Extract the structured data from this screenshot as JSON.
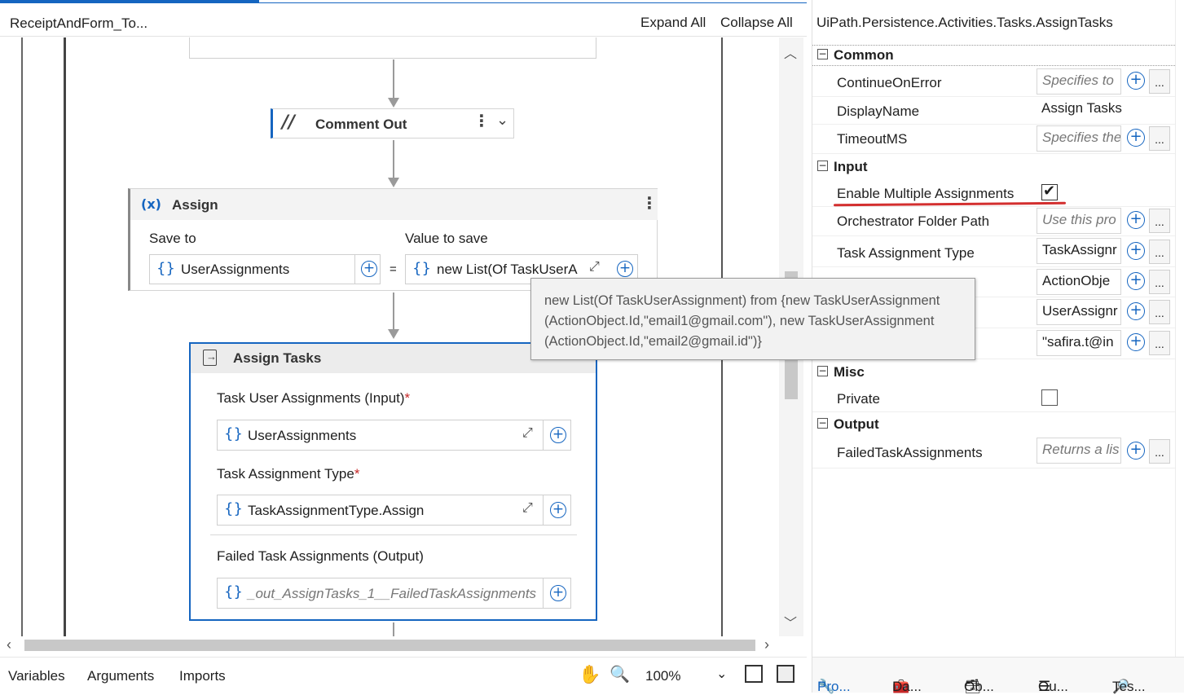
{
  "header": {
    "title": "ReceiptAndForm_To...",
    "expand_all": "Expand All",
    "collapse_all": "Collapse All"
  },
  "comment_out": {
    "label": "Comment Out"
  },
  "assign": {
    "title": "Assign",
    "save_to_label": "Save to",
    "value_label": "Value to save",
    "save_to_value": "UserAssignments",
    "value_value": "new List(Of TaskUserA",
    "equals": "="
  },
  "assign_tasks": {
    "title": "Assign Tasks",
    "field1_label": "Task User Assignments (Input)",
    "field1_value": "UserAssignments",
    "field2_label": "Task Assignment Type",
    "field2_value": "TaskAssignmentType.Assign",
    "field3_label": "Failed Task Assignments (Output)",
    "field3_value": "_out_AssignTasks_1__FailedTaskAssignments",
    "required_mark": "*"
  },
  "tooltip": {
    "line1": "new List(Of TaskUserAssignment) from {new TaskUserAssignment",
    "line2": "(ActionObject.Id,\"email1@gmail.com\"), new TaskUserAssignment",
    "line3": "(ActionObject.Id,\"email2@gmail.id\")}"
  },
  "bottom": {
    "variables": "Variables",
    "arguments": "Arguments",
    "imports": "Imports",
    "zoom": "100%"
  },
  "properties": {
    "title": "UiPath.Persistence.Activities.Tasks.AssignTasks",
    "cat_common": "Common",
    "cat_input": "Input",
    "cat_misc": "Misc",
    "cat_output": "Output",
    "continue_on_error": {
      "name": "ContinueOnError",
      "value": "Specifies to"
    },
    "display_name": {
      "name": "DisplayName",
      "value": "Assign Tasks"
    },
    "timeout": {
      "name": "TimeoutMS",
      "value": "Specifies the"
    },
    "enable_multiple": {
      "name": "Enable Multiple Assignments",
      "checked": true
    },
    "folder_path": {
      "name": "Orchestrator Folder Path",
      "value": "Use this pro"
    },
    "task_assignment_type": {
      "name": "Task Assignment Type",
      "value": "TaskAssignr"
    },
    "hidden1": {
      "value": "ActionObje"
    },
    "hidden2": {
      "value": "UserAssignr"
    },
    "hidden3": {
      "value": "\"safira.t@in"
    },
    "private": {
      "name": "Private",
      "checked": false
    },
    "failed": {
      "name": "FailedTaskAssignments",
      "value": "Returns a lis"
    },
    "dots": "..."
  },
  "panel_tabs": [
    "Pro...",
    "Da...",
    "Ob...",
    "Ou...",
    "Tes..."
  ],
  "colors": {
    "accent": "#1565c0",
    "highlight": "#d32f2f"
  }
}
